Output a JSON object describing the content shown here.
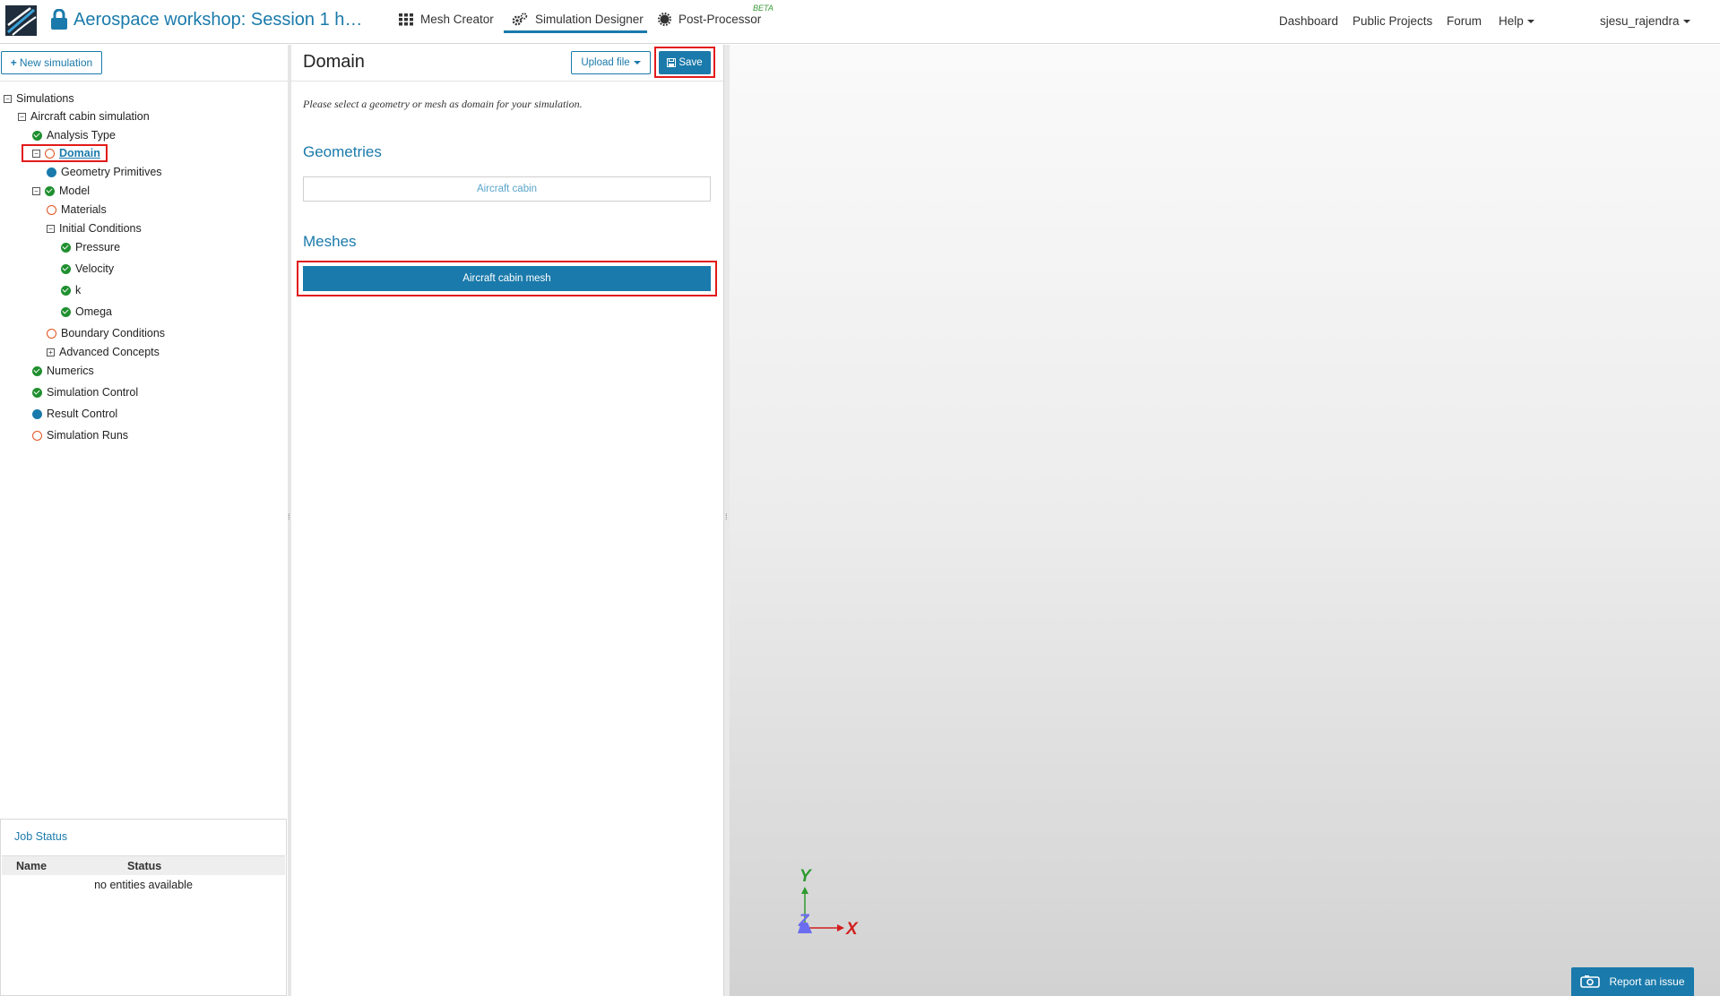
{
  "header": {
    "project_title": "Aerospace workshop: Session 1 h…",
    "tabs": [
      {
        "label": "Mesh Creator",
        "icon": "grid-icon"
      },
      {
        "label": "Simulation Designer",
        "icon": "gears-icon",
        "active": true
      },
      {
        "label": "Post-Processor",
        "icon": "gear-icon",
        "badge": "BETA"
      }
    ],
    "links": [
      "Dashboard",
      "Public Projects",
      "Forum",
      "Help"
    ],
    "user": "sjesu_rajendra"
  },
  "left": {
    "new_simulation": "New simulation",
    "tree": {
      "root": "Simulations",
      "simulation": "Aircraft cabin simulation",
      "analysis_type": "Analysis Type",
      "domain": "Domain",
      "geometry_primitives": "Geometry Primitives",
      "model": "Model",
      "materials": "Materials",
      "initial_conditions": "Initial Conditions",
      "pressure": "Pressure",
      "velocity": "Velocity",
      "k": "k",
      "omega": "Omega",
      "boundary_conditions": "Boundary Conditions",
      "advanced_concepts": "Advanced Concepts",
      "numerics": "Numerics",
      "simulation_control": "Simulation Control",
      "result_control": "Result Control",
      "simulation_runs": "Simulation Runs"
    },
    "job_status": {
      "title": "Job Status",
      "col_name": "Name",
      "col_status": "Status",
      "empty": "no entities available"
    }
  },
  "middle": {
    "title": "Domain",
    "upload_file": "Upload file",
    "save": "Save",
    "hint": "Please select a geometry or mesh as domain for your simulation.",
    "geometries_title": "Geometries",
    "geometry_item": "Aircraft cabin",
    "meshes_title": "Meshes",
    "mesh_item": "Aircraft cabin mesh"
  },
  "viewer": {
    "axis_x": "X",
    "axis_y": "Y",
    "axis_z": "Z",
    "report_issue": "Report an issue"
  },
  "colors": {
    "accent": "#1a7aab",
    "ok": "#1f8f2f",
    "pending": "#e0531f",
    "highlight": "#e21a1a"
  }
}
